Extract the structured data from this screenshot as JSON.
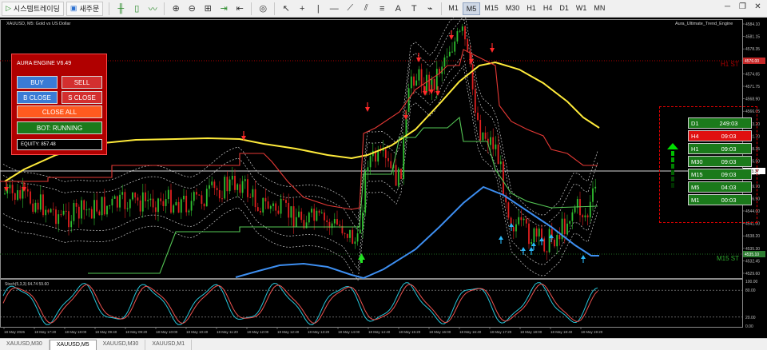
{
  "toolbar": {
    "buttons": [
      {
        "label": "시스템트레이딩",
        "icon": "play-icon"
      },
      {
        "label": "새주문",
        "icon": "new-order-icon"
      }
    ],
    "timeframes": [
      "M1",
      "M5",
      "M15",
      "M30",
      "H1",
      "H4",
      "D1",
      "W1",
      "MN"
    ],
    "active_timeframe": "M5"
  },
  "chart": {
    "header": "XAUUSD, M5:  Gold vs US Dollar",
    "indicator_name": "Aura_Ultimate_Trend_Engine",
    "h1_st_label": "H1 ST",
    "m15_st_label": "M15 ST",
    "stoch_label": "Stoch(5,3,3) 64.74 59.60",
    "price_axis": [
      "4584.10",
      "4581.15",
      "4578.35",
      "4575.75",
      "4574.65",
      "4571.75",
      "4568.90",
      "4566.05",
      "4563.20",
      "4561.70",
      "4558.35",
      "4555.50",
      "4552.65",
      "4549.70",
      "4546.90",
      "4544.00",
      "4541.00",
      "4538.20",
      "4535.30",
      "4532.45",
      "4529.60"
    ],
    "price_tags": [
      {
        "text": "4576.00",
        "color": "#c62828"
      },
      {
        "text": "4553.37",
        "color": "#ffffff"
      },
      {
        "text": "4535.10",
        "color": "#2e7d32"
      }
    ],
    "stoch_axis": [
      "100.00",
      "80.00",
      "20.00",
      "0.00"
    ],
    "time_axis": [
      "18 May 2026",
      "18 May 17:20",
      "18 May 18:00",
      "18 May 09:40",
      "18 May 09:20",
      "18 May 10:00",
      "18 May 10:40",
      "18 May 11:20",
      "18 May 12:00",
      "18 May 12:40",
      "18 May 13:20",
      "18 May 14:00",
      "18 May 14:40",
      "18 May 15:20",
      "18 May 16:00",
      "18 May 16:40",
      "18 May 17:20",
      "18 May 18:00",
      "18 May 18:40",
      "18 May 19:20"
    ]
  },
  "aura_panel": {
    "title": "AURA ENGINE V6.49",
    "buy": "BUY",
    "sell": "SELL",
    "b_close": "B CLOSE",
    "s_close": "S CLOSE",
    "close_all": "CLOSE ALL",
    "bot_status": "BOT: RUNNING",
    "equity": "EQUITY: 857.48",
    "colors": {
      "buy": "#3a7bd5",
      "sell": "#d32f2f",
      "close_all": "#ff5a1f",
      "bot": "#1b7a1b"
    }
  },
  "tf_panel": {
    "rows": [
      {
        "tf": "D1",
        "time": "249:03",
        "state": "bull"
      },
      {
        "tf": "H4",
        "time": "09:03",
        "state": "bear"
      },
      {
        "tf": "H1",
        "time": "09:03",
        "state": "bull"
      },
      {
        "tf": "M30",
        "time": "09:03",
        "state": "bull"
      },
      {
        "tf": "M15",
        "time": "09:03",
        "state": "bull"
      },
      {
        "tf": "M5",
        "time": "04:03",
        "state": "bull"
      },
      {
        "tf": "M1",
        "time": "00:03",
        "state": "bull"
      }
    ],
    "colors": {
      "bull": "#1b7a1b",
      "bear": "#e01010"
    }
  },
  "tabs": [
    {
      "label": "XAUUSD,M30",
      "active": false
    },
    {
      "label": "XAUUSD,M5",
      "active": true
    },
    {
      "label": "XAUUSD,M30",
      "active": false
    },
    {
      "label": "XAUUSD,M1",
      "active": false
    }
  ]
}
